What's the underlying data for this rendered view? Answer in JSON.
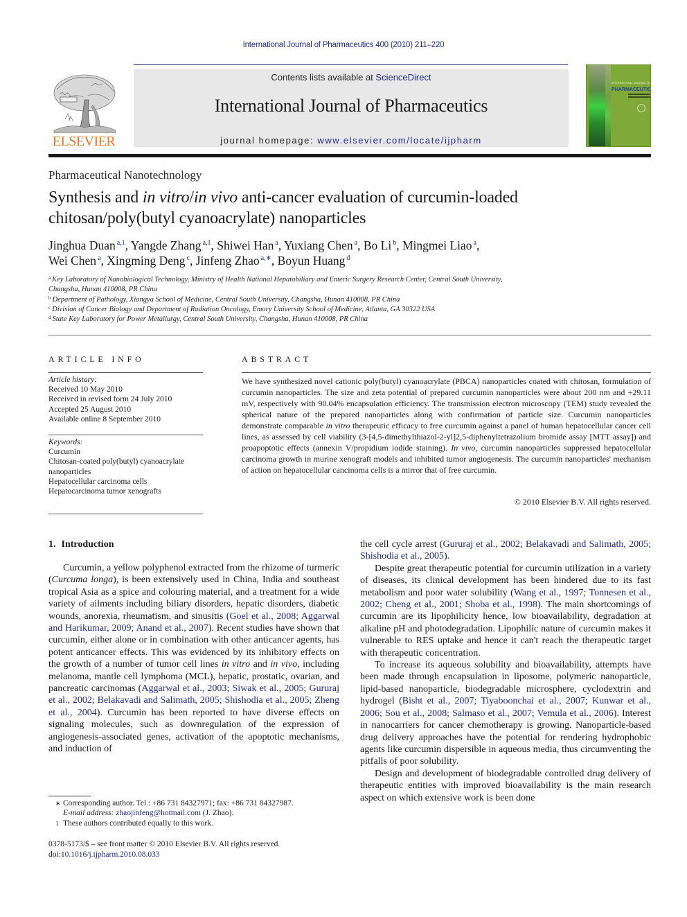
{
  "running_head": "International Journal of Pharmaceutics 400 (2010) 211–220",
  "masthead": {
    "publisher_logo_text": "ELSEVIER",
    "contents_prefix": "Contents lists available at ",
    "contents_link": "ScienceDirect",
    "journal_name": "International Journal of Pharmaceutics",
    "homepage_prefix": "journal homepage: ",
    "homepage_url": "www.elsevier.com/locate/ijpharm",
    "cover": {
      "small_line": "INTERNATIONAL JOURNAL OF",
      "title": "PHARMACEUTICS"
    },
    "colors": {
      "publisher_orange": "#e87722",
      "link_blue": "#1f2a8a",
      "masthead_gray": "#e8e8e9",
      "cover_green": "#7faa3a"
    }
  },
  "section_label": "Pharmaceutical Nanotechnology",
  "title": {
    "part1": "Synthesis and ",
    "italic1": "in vitro",
    "slash": "/",
    "italic2": "in vivo",
    "part2": " anti-cancer evaluation of curcumin-loaded chitosan/poly(butyl cyanoacrylate) nanoparticles"
  },
  "authors": [
    {
      "name": "Jinghua Duan",
      "sup": "a,1"
    },
    {
      "name": "Yangde Zhang",
      "sup": "a,1"
    },
    {
      "name": "Shiwei Han",
      "sup": "a"
    },
    {
      "name": "Yuxiang Chen",
      "sup": "a"
    },
    {
      "name": "Bo Li",
      "sup": "b"
    },
    {
      "name": "Mingmei Liao",
      "sup": "a"
    },
    {
      "name": "Wei Chen",
      "sup": "a"
    },
    {
      "name": "Xingming Deng",
      "sup": "c"
    },
    {
      "name": "Jinfeng Zhao",
      "sup": "a,∗"
    },
    {
      "name": "Boyun Huang",
      "sup": "d"
    }
  ],
  "affiliations": [
    {
      "mark": "a",
      "text": "Key Laboratory of Nanobiological Technology, Ministry of Health National Hepatobiliary and Enteric Surgery Research Center, Central South University, Changsha, Hunan 410008, PR China"
    },
    {
      "mark": "b",
      "text": "Department of Pathology, Xiangya School of Medicine, Central South University, Changsha, Hunan 410008, PR China"
    },
    {
      "mark": "c",
      "text": "Division of Cancer Biology and Department of Radiation Oncology, Emory University School of Medicine, Atlanta, GA 30322 USA"
    },
    {
      "mark": "d",
      "text": "State Key Laboratory for Power Metallurgy, Central South University, Changsha, Hunan 410008, PR China"
    }
  ],
  "article_info": {
    "heading": "ARTICLE INFO",
    "history_label": "Article history:",
    "history": [
      "Received 10 May 2010",
      "Received in revised form 24 July 2010",
      "Accepted 25 August 2010",
      "Available online 8 September 2010"
    ],
    "keywords_label": "Keywords:",
    "keywords": [
      "Curcumin",
      "Chitosan-coated poly(butyl) cyanoacrylate nanoparticles",
      "Hepatocellular carcinoma cells",
      "Hepatocarcinoma tumor xenografts"
    ]
  },
  "abstract": {
    "heading": "ABSTRACT",
    "seg1": "We have synthesized novel cationic poly(butyl) cyanoacrylate (PBCA) nanoparticles coated with chitosan, formulation of curcumin nanoparticles. The size and zeta potential of prepared curcumin nanoparticles were about 200 nm and +29.11 mV, respectively with 90.04% encapsulation efficiency. The transmission electron microscopy (TEM) study revealed the spherical nature of the prepared nanoparticles along with confirmation of particle size. Curcumin nanoparticles demonstrate comparable ",
    "italic1": "in vitro",
    "seg2": " therapeutic efficacy to free curcumin against a panel of human hepatocellular cancer cell lines, as assessed by cell viability (3-[4,5-dimethylthiazol-2-yl]2,5-diphenyltetrazolium bromide assay [MTT assay]) and proapoptotic effects (annexin V/propidium iodide staining). ",
    "italic2": "In vivo",
    "seg3": ", curcumin nanoparticles suppressed hepatocellular carcinoma growth in murine xenograft models and inhibited tumor angiogenesis. The curcumin nanoparticles' mechanism of action on hepatocellular cancinoma cells is a mirror that of free curcumin.",
    "copyright": "© 2010 Elsevier B.V. All rights reserved."
  },
  "introduction": {
    "number": "1.",
    "heading": "Introduction",
    "p1": {
      "a": "Curcumin, a yellow polyphenol extracted from the rhizome of turmeric (",
      "a_it": "Curcuma longa",
      "b": "), is been extensively used in China, India and southeast tropical Asia as a spice and colouring material, and a treatment for a wide variety of ailments including biliary disorders, hepatic disorders, diabetic wounds, anorexia, rheumatism, and sinusitis (",
      "cite1": "Goel et al., 2008; Aggarwal and Harikumar, 2009; Anand et al., 2007",
      "c": "). Recent studies have shown that curcumin, either alone or in combination with other anticancer agents, has potent anticancer effects. This was evidenced by its inhibitory effects on the growth of a number of tumor cell lines ",
      "c_it1": "in vitro",
      "d": " and ",
      "d_it2": "in vivo",
      "e": ", including melanoma, mantle cell lymphoma (MCL), hepatic, prostatic, ovarian, and pancreatic carcinomas (",
      "cite2": "Aggarwal et al., 2003; Siwak et al., 2005; Gururaj et al., 2002; Belakavadi and Salimath, 2005; Shishodia et al., 2005; Zheng et al., 2004",
      "f": "). Curcumin has been reported to have diverse effects on signaling molecules, such as downregulation of the expression of angiogenesis-associated genes, activation of the apoptotic mechanisms, and induction of"
    },
    "p1_cont": {
      "a": "the cell cycle arrest (",
      "cite": "Gururaj et al., 2002; Belakavadi and Salimath, 2005; Shishodia et al., 2005",
      "b": ")."
    },
    "p2": {
      "a": "Despite great therapeutic potential for curcumin utilization in a variety of diseases, its clinical development has been hindered due to its fast metabolism and poor water solubility (",
      "cite": "Wang et al., 1997; Tonnesen et al., 2002; Cheng et al., 2001; Shoba et al., 1998",
      "b": "). The main shortcomings of curcumin are its lipophilicity hence, low bioavailability, degradation at alkaline pH and photodegradation. Lipophilic nature of curcumin makes it vulnerable to RES uptake and hence it can't reach the therapeutic target with therapeutic concentration."
    },
    "p3": {
      "a": "To increase its aqueous solubility and bioavailability, attempts have been made through encapsulation in liposome, polymeric nanoparticle, lipid-based nanoparticle, biodegradable microsphere, cyclodextrin and hydrogel (",
      "cite": "Bisht et al., 2007; Tiyaboonchai et al., 2007; Kunwar et al., 2006; Sou et al., 2008; Salmaso et al., 2007; Vemula et al., 2006",
      "b": "). Interest in nanocarriers for cancer chemotherapy is growing. Nanoparticle-based drug delivery approaches have the potential for rendering hydrophobic agents like curcumin dispersible in aqueous media, thus circumventing the pitfalls of poor solubility."
    },
    "p4": "Design and development of biodegradable controlled drug delivery of therapeutic entities with improved bioavailability is the main research aspect on which extensive work is been done"
  },
  "footnotes": {
    "corresponding_mark": "∗",
    "corresponding": "Corresponding author. Tel.: +86 731 84327971; fax: +86 731 84327987.",
    "email_label": "E-mail address:",
    "email": "zhaojinfeng@hotmail.com",
    "email_suffix": " (J. Zhao).",
    "equal_mark": "1",
    "equal": "These authors contributed equally to this work."
  },
  "front_matter": {
    "issn_line": "0378-5173/$ – see front matter © 2010 Elsevier B.V. All rights reserved.",
    "doi_prefix": "doi:",
    "doi": "10.1016/j.ijpharm.2010.08.033"
  }
}
